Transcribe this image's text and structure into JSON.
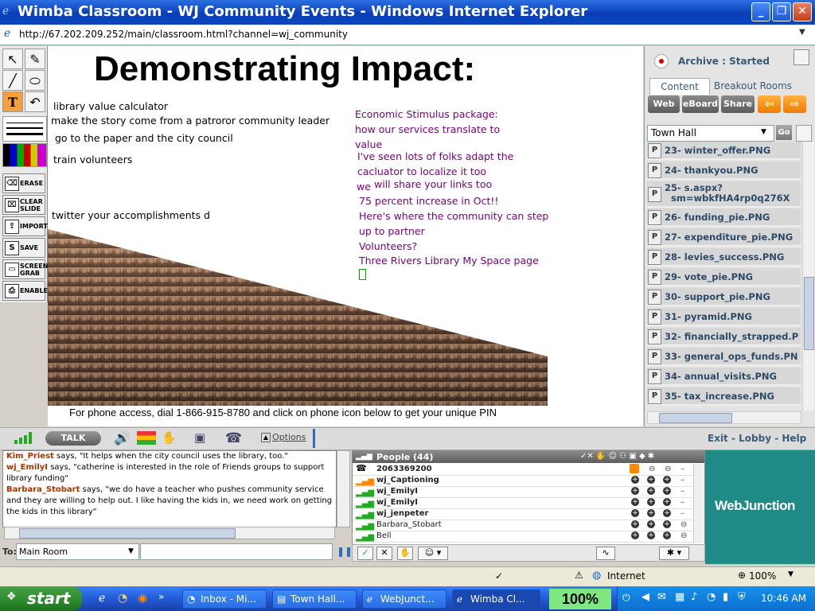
{
  "window": {
    "title": "Wimba Classroom - WJ Community Events - Windows Internet Explorer",
    "url": "http://67.202.209.252/main/classroom.html?channel=wj_community"
  },
  "tools": {
    "erase": "ERASE",
    "clear_slide_1": "CLEAR",
    "clear_slide_2": "SLIDE",
    "import": "IMPORT",
    "save": "SAVE",
    "screen_grab_1": "SCREEN",
    "screen_grab_2": "GRAB",
    "enable": "ENABLE"
  },
  "board": {
    "title": "Demonstrating Impact:",
    "left_notes": [
      "library value calculator",
      "make the story come from a patroror community leader",
      "go to the paper and the city council",
      "train volunteers",
      "twitter your accomplishments d"
    ],
    "right_notes": [
      "Economic Stimulus package:",
      "how our services translate to",
      "value",
      "I've seen lots of folks adapt the",
      "cacluator to localize it too",
      "we",
      "will share your links too",
      "75 percent increase in Oct!!",
      "Here's where the community can step",
      "up to partner",
      "Volunteers?",
      "Three Rivers Library My Space page"
    ],
    "phone_note": "For phone access, dial 1-866-915-8780 and click on phone icon below to get your unique PIN"
  },
  "right_panel": {
    "archive": "Archive : Started",
    "tabs": [
      "Content",
      "Breakout Rooms"
    ],
    "buttons": [
      "Web",
      "eBoard",
      "Share"
    ],
    "room_select": "Town Hall",
    "go": "Go",
    "slides": [
      "23- winter_offer.PNG",
      "24- thankyou.PNG",
      "25- s.aspx?",
      "sm=wbkfHA4rp0q276X",
      "26- funding_pie.PNG",
      "27- expenditure_pie.PNG",
      "28- levies_success.PNG",
      "29- vote_pie.PNG",
      "30- support_pie.PNG",
      "31- pyramid.PNG",
      "32- financially_strapped.P",
      "33- general_ops_funds.PN",
      "34- annual_visits.PNG",
      "35- tax_increase.PNG"
    ]
  },
  "media": {
    "talk": "TALK",
    "options": "Options",
    "links": "Exit - Lobby - Help"
  },
  "chat": {
    "messages": [
      {
        "who": "Kim_Priest",
        "text": " says, \"It helps when the city council uses the library, too.\""
      },
      {
        "who": "wj_EmilyI",
        "text": " says, \"catherine is interested in the role of Friends groups to support library funding\""
      },
      {
        "who": "Barbara_Stobart",
        "text": " says, \"we do have a teacher who pushes community service and they are willing to help out. I like having the kids in, we need work on getting the kids in this library\""
      }
    ],
    "to_label": "To:",
    "to_value": "Main Room"
  },
  "people": {
    "header": "People (44)",
    "rows": [
      "2063369200",
      "wj_Captioning",
      "wj_EmilyI",
      "wj_EmilyI",
      "wj_jenpeter",
      "Barbara_Stobart",
      "Bell"
    ]
  },
  "brand": "WebJunction",
  "status": {
    "zone": "Internet",
    "zoom": "100%"
  },
  "taskbar": {
    "start": "start",
    "tasks": [
      "Inbox - Mi...",
      "Town Hall...",
      "WebJunct...",
      "Wimba Cl..."
    ],
    "battery": "100%",
    "clock": "10:46 AM"
  },
  "colors": {
    "accent_blue": "#0b46c4",
    "note_purple": "#7a007a",
    "slide_text": "#2c4a66",
    "brand_teal": "#1f8a86",
    "orange": "#ee7a00"
  }
}
